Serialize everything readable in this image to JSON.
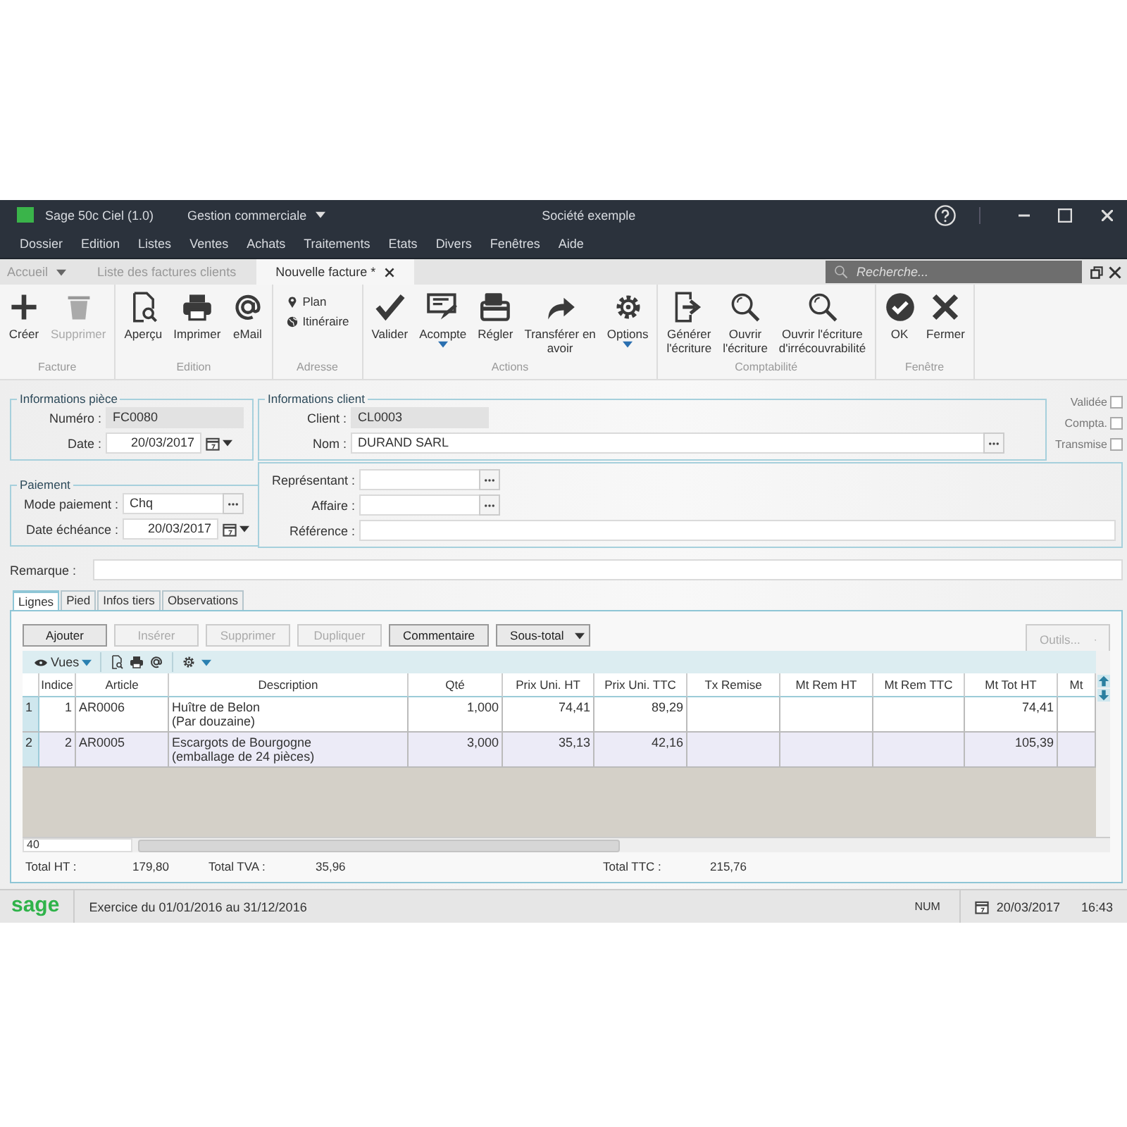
{
  "window": {
    "app": "Sage 50c Ciel (1.0)",
    "module": "Gestion commerciale",
    "company": "Société exemple"
  },
  "menu": [
    "Dossier",
    "Edition",
    "Listes",
    "Ventes",
    "Achats",
    "Traitements",
    "Etats",
    "Divers",
    "Fenêtres",
    "Aide"
  ],
  "tabs": [
    {
      "label": "Accueil",
      "kind": "home",
      "selected": false
    },
    {
      "label": "Liste des factures clients",
      "kind": "page",
      "selected": false
    },
    {
      "label": "Nouvelle facture *",
      "kind": "page",
      "selected": true
    }
  ],
  "search": {
    "placeholder": "Recherche..."
  },
  "ribbon": [
    {
      "label": "Facture",
      "items": [
        {
          "label": "Créer",
          "kind": "large",
          "disabled": false
        },
        {
          "label": "Supprimer",
          "kind": "large",
          "disabled": true
        }
      ]
    },
    {
      "label": "Edition",
      "items": [
        {
          "label": "Aperçu",
          "kind": "large",
          "disabled": false
        },
        {
          "label": "Imprimer",
          "kind": "large",
          "disabled": false
        },
        {
          "label": "eMail",
          "kind": "large",
          "disabled": false
        }
      ]
    },
    {
      "label": "Adresse",
      "items": [
        {
          "label": "Plan",
          "kind": "small",
          "disabled": false
        },
        {
          "label": "Itinéraire",
          "kind": "small",
          "disabled": false
        }
      ]
    },
    {
      "label": "Actions",
      "items": [
        {
          "label": "Valider",
          "kind": "large",
          "disabled": false
        },
        {
          "label": "Acompte",
          "kind": "split",
          "disabled": false
        },
        {
          "label": "Régler",
          "kind": "large",
          "disabled": false
        },
        {
          "label": "Transférer en\navoir",
          "kind": "large",
          "disabled": false
        },
        {
          "label": "Options",
          "kind": "split",
          "disabled": false
        }
      ]
    },
    {
      "label": "Comptabilité",
      "items": [
        {
          "label": "Générer\nl'écriture",
          "kind": "large",
          "disabled": false
        },
        {
          "label": "Ouvrir\nl'écriture",
          "kind": "large",
          "disabled": false
        },
        {
          "label": "Ouvrir l'écriture\nd'irrécouvrabilité",
          "kind": "large",
          "disabled": false
        }
      ]
    },
    {
      "label": "Fenêtre",
      "items": [
        {
          "label": "OK",
          "kind": "large",
          "disabled": false
        },
        {
          "label": "Fermer",
          "kind": "large",
          "disabled": false
        }
      ]
    }
  ],
  "piece": {
    "title": "Informations pièce",
    "fields": [
      {
        "label": "Numéro :",
        "value": "FC0080",
        "kind": "readonly"
      },
      {
        "label": "Date :",
        "value": "20/03/2017",
        "kind": "date"
      }
    ]
  },
  "client": {
    "title": "Informations client",
    "fields": [
      {
        "label": "Client :",
        "value": "CL0003",
        "kind": "readonly"
      },
      {
        "label": "Nom :",
        "value": "DURAND SARL",
        "kind": "lookup"
      }
    ]
  },
  "flags": [
    {
      "label": "Validée",
      "checked": false
    },
    {
      "label": "Compta.",
      "checked": false
    },
    {
      "label": "Transmise",
      "checked": false
    }
  ],
  "paiement": {
    "title": "Paiement",
    "fields": [
      {
        "label": "Mode paiement :",
        "value": "Chq",
        "kind": "lookup"
      },
      {
        "label": "Date échéance :",
        "value": "20/03/2017",
        "kind": "date"
      }
    ]
  },
  "other_fields": [
    {
      "label": "Représentant :",
      "kind": "lookup"
    },
    {
      "label": "Affaire :",
      "kind": "lookup"
    },
    {
      "label": "Référence :",
      "kind": "text"
    }
  ],
  "remarque": {
    "label": "Remarque :"
  },
  "doc_tabs": [
    {
      "label": "Lignes",
      "selected": true
    },
    {
      "label": "Pied",
      "selected": false
    },
    {
      "label": "Infos tiers",
      "selected": false
    },
    {
      "label": "Observations",
      "selected": false
    }
  ],
  "actions": [
    {
      "label": "Ajouter",
      "kind": "button",
      "disabled": false
    },
    {
      "label": "Insérer",
      "kind": "button",
      "disabled": true
    },
    {
      "label": "Supprimer",
      "kind": "button",
      "disabled": true
    },
    {
      "label": "Dupliquer",
      "kind": "button",
      "disabled": true
    },
    {
      "label": "Commentaire",
      "kind": "button",
      "disabled": false
    },
    {
      "label": "Sous-total",
      "kind": "split",
      "disabled": false
    },
    {
      "label": "Outils...",
      "kind": "menu",
      "disabled": true
    }
  ],
  "grid_toolbar": {
    "views": "Vues"
  },
  "table": {
    "columns": [
      "Indice",
      "Article",
      "Description",
      "Qté",
      "Prix Uni. HT",
      "Prix Uni. TTC",
      "Tx Remise",
      "Mt Rem HT",
      "Mt Rem TTC",
      "Mt Tot HT",
      "Mt"
    ],
    "rows": [
      {
        "number": "1",
        "selected": false,
        "cells": [
          "1",
          "AR0006",
          "Huître de Belon\n(Par douzaine)",
          "1,000",
          "74,41",
          "89,29",
          null,
          null,
          null,
          "74,41",
          null
        ]
      },
      {
        "number": "2",
        "selected": true,
        "cells": [
          "2",
          "AR0005",
          "Escargots de Bourgogne\n(emballage de 24 pièces)",
          "3,000",
          "35,13",
          "42,16",
          null,
          null,
          null,
          "105,39",
          null
        ]
      }
    ],
    "row_count": "40"
  },
  "totals": [
    {
      "label": "Total HT :",
      "value": "179,80"
    },
    {
      "label": "Total TVA :",
      "value": "35,96"
    },
    {
      "label": "Total TTC :",
      "value": "215,76"
    }
  ],
  "status_bar": {
    "logo": "sage",
    "exercise": "Exercice du 01/01/2016 au 31/12/2016",
    "num": "NUM",
    "date": "20/03/2017",
    "time": "16:43"
  }
}
